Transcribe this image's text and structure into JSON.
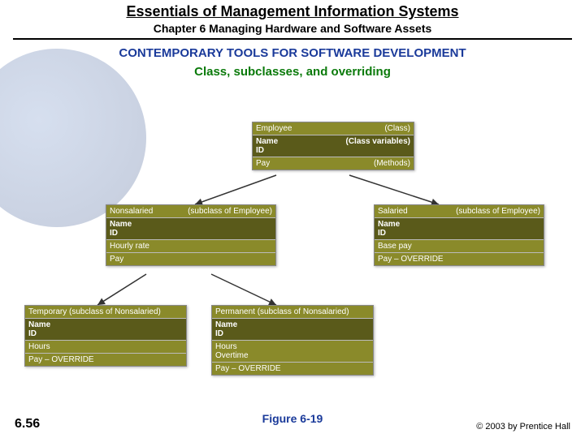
{
  "header": {
    "title": "Essentials of Management Information Systems",
    "chapter": "Chapter 6 Managing Hardware and Software Assets",
    "section": "CONTEMPORARY TOOLS FOR SOFTWARE DEVELOPMENT",
    "subtitle": "Class, subclasses, and overriding"
  },
  "diagram": {
    "employee": {
      "title_left": "Employee",
      "title_right": "(Class)",
      "vars_left": "Name\nID",
      "vars_right": "(Class variables)",
      "meth_left": "Pay",
      "meth_right": "(Methods)"
    },
    "nonsalaried": {
      "title": "Nonsalaried",
      "note": "(subclass of Employee)",
      "vars": "Name\nID",
      "extra": "Hourly rate",
      "meth": "Pay"
    },
    "salaried": {
      "title": "Salaried",
      "note": "(subclass of Employee)",
      "vars": "Name\nID",
      "extra": "Base pay",
      "meth": "Pay – OVERRIDE"
    },
    "temporary": {
      "title": "Temporary (subclass of Nonsalaried)",
      "vars": "Name\nID",
      "extra": "Hours",
      "meth": "Pay – OVERRIDE"
    },
    "permanent": {
      "title": "Permanent (subclass of Nonsalaried)",
      "vars": "Name\nID",
      "extra": "Hours\nOvertime",
      "meth": "Pay – OVERRIDE"
    }
  },
  "footer": {
    "figure": "Figure 6-19",
    "page": "6.56",
    "copyright": "© 2003 by Prentice Hall"
  }
}
